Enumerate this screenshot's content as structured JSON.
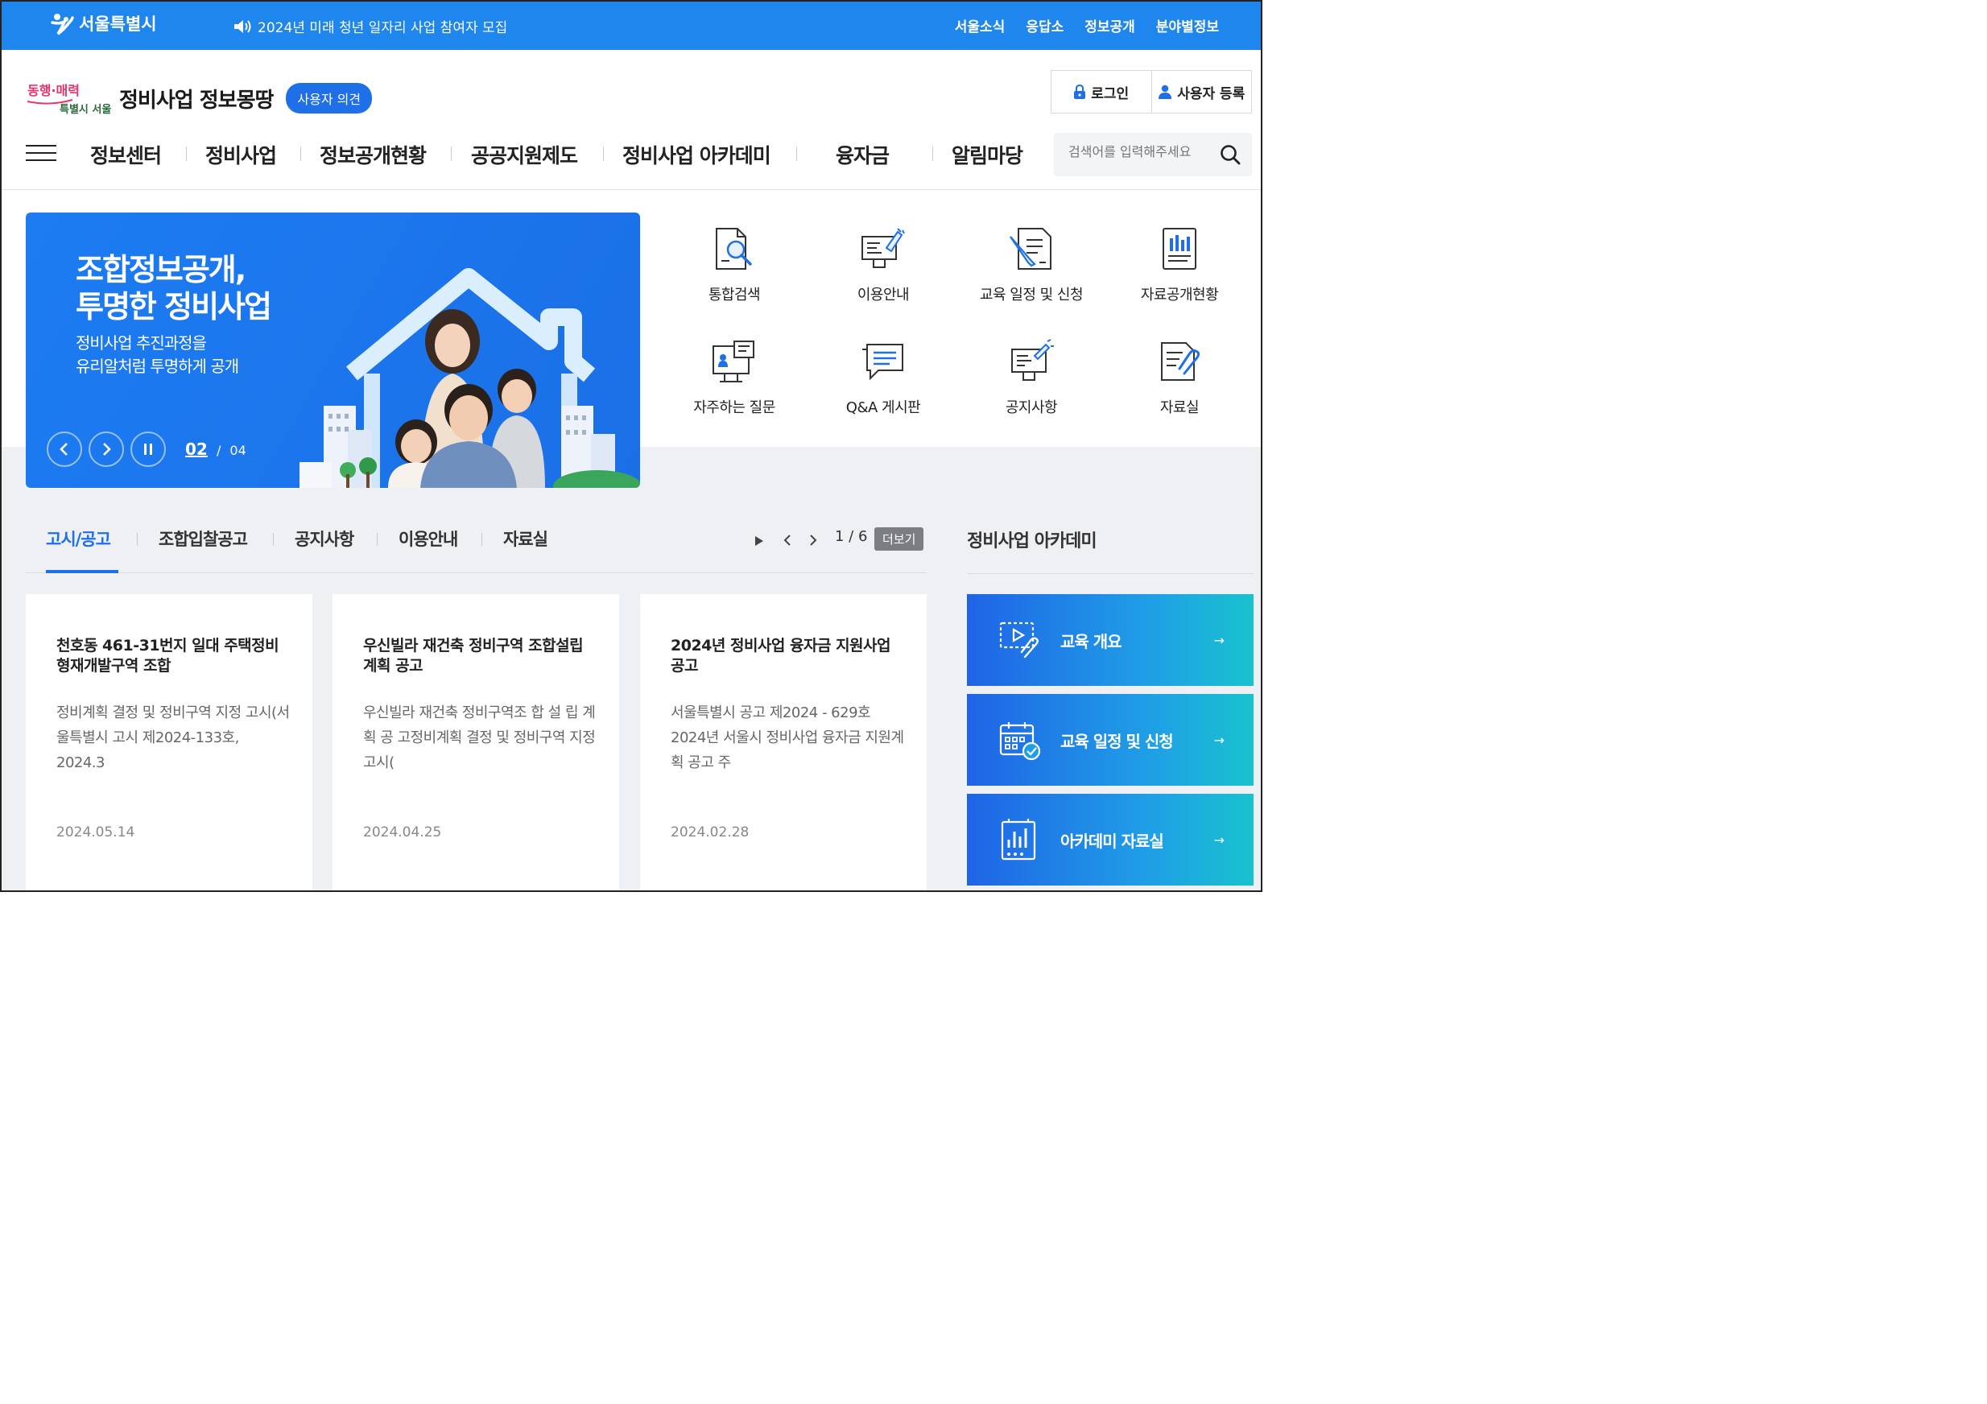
{
  "topbar": {
    "logo_text": "서울특별시",
    "notice": "2024년 미래 청년 일자리 사업 참여자 모집",
    "links": [
      "서울소식",
      "응답소",
      "정보공개",
      "분야별정보"
    ],
    "color": "#1f86ee"
  },
  "header": {
    "slogan_logo": "동행·매력 특별시 서울",
    "site_title": "정비사업 정보몽땅",
    "opinion_button": "사용자 의견",
    "login": "로그인",
    "register": "사용자 등록"
  },
  "gnb": {
    "items": [
      "정보센터",
      "정비사업",
      "정보공개현황",
      "공공지원제도",
      "정비사업 아카데미",
      "융자금",
      "알림마당"
    ],
    "search_placeholder": "검색어를 입력해주세요"
  },
  "hero": {
    "title_line1": "조합정보공개,",
    "title_line2": "투명한 정비사업",
    "sub_line1": "정비사업 추진과정을",
    "sub_line2": "유리알처럼 투명하게 공개",
    "current": "02",
    "separator": "/",
    "total": "04",
    "color": "#1d7cf2"
  },
  "quick_menu": [
    {
      "label": "통합검색",
      "icon": "document-search-icon"
    },
    {
      "label": "이용안내",
      "icon": "monitor-guide-icon"
    },
    {
      "label": "교육 일정 및 신청",
      "icon": "document-pen-icon"
    },
    {
      "label": "자료공개현황",
      "icon": "chart-document-icon"
    },
    {
      "label": "자주하는 질문",
      "icon": "faq-board-icon"
    },
    {
      "label": "Q&A 게시판",
      "icon": "chat-bubble-icon"
    },
    {
      "label": "공지사항",
      "icon": "announcement-icon"
    },
    {
      "label": "자료실",
      "icon": "paperclip-document-icon"
    }
  ],
  "tabs": {
    "items": [
      "고시/공고",
      "조합입찰공고",
      "공지사항",
      "이용안내",
      "자료실"
    ],
    "active_index": 0,
    "page": "1 / 6",
    "more": "더보기",
    "accent": "#1f6fe8"
  },
  "cards": [
    {
      "title": "천호동 461-31번지 일대 주택정비형재개발구역 조합",
      "body": "정비계획 결정 및 정비구역 지정 고시(서울특별시 고시 제2024-133호, 2024.3",
      "date": "2024.05.14"
    },
    {
      "title": "우신빌라 재건축 정비구역 조합설립계획 공고",
      "body": "우신빌라 재건축 정비구역조 합 설 립 계 획 공 고정비계획 결정 및 정비구역 지정 고시(",
      "date": "2024.04.25"
    },
    {
      "title": "2024년 정비사업 융자금 지원사업 공고",
      "body": "서울특별시 공고 제2024 - 629호 2024년 서울시 정비사업 융자금 지원계획 공고 주",
      "date": "2024.02.28"
    }
  ],
  "academy": {
    "title": "정비사업 아카데미",
    "items": [
      {
        "label": "교육 개요",
        "icon": "video-lesson-icon"
      },
      {
        "label": "교육 일정 및 신청",
        "icon": "calendar-check-icon"
      },
      {
        "label": "아카데미 자료실",
        "icon": "data-chart-icon"
      }
    ],
    "arrow": "→"
  }
}
